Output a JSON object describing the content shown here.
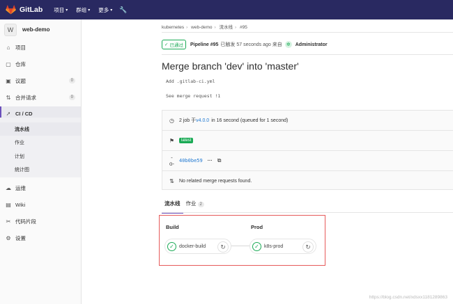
{
  "topnav": {
    "brand": "GitLab",
    "items": [
      {
        "label": "项目"
      },
      {
        "label": "群组"
      },
      {
        "label": "更多"
      }
    ]
  },
  "sidebar": {
    "project_initial": "W",
    "project_name": "web-demo",
    "items": [
      {
        "label": "项目",
        "icon": "home-icon"
      },
      {
        "label": "仓库",
        "icon": "repo-icon"
      },
      {
        "label": "议题",
        "icon": "issues-icon",
        "count": "0"
      },
      {
        "label": "合并请求",
        "icon": "merge-request-icon",
        "count": "0"
      },
      {
        "label": "CI / CD",
        "icon": "rocket-icon"
      },
      {
        "label": "运维",
        "icon": "cloud-icon"
      },
      {
        "label": "Wiki",
        "icon": "book-icon"
      },
      {
        "label": "代码片段",
        "icon": "snippet-icon"
      },
      {
        "label": "设置",
        "icon": "gear-icon"
      }
    ],
    "cicd_sub": [
      {
        "label": "流水线"
      },
      {
        "label": "作业"
      },
      {
        "label": "计划"
      },
      {
        "label": "统计图"
      }
    ]
  },
  "breadcrumb": [
    "kubernetes",
    "web-demo",
    "流水线",
    "#95"
  ],
  "pipeline": {
    "status": "已通过",
    "id_label": "Pipeline #95",
    "triggered_text": "已触发 57 seconds ago 来自",
    "user": "Administrator",
    "title": "Merge branch 'dev' into 'master'",
    "commit_lines": [
      "Add .gitlab-ci.yml",
      "See merge request !1"
    ],
    "jobs_text_1": "2 job 于",
    "tag": "v4.0.0",
    "jobs_text_2": "in 16 second (queued for 1 second)",
    "latest_badge": "latest",
    "sha": "40b0be59",
    "ellipsis": "···",
    "no_mr": "No related merge requests found."
  },
  "tabs": [
    {
      "label": "流水线"
    },
    {
      "label": "作业",
      "count": "2"
    }
  ],
  "graph": {
    "stages": [
      {
        "name": "Build",
        "job": "docker-build"
      },
      {
        "name": "Prod",
        "job": "k8s-prod"
      }
    ]
  },
  "watermark": "https://blog.csdn.net/xdsxx1181289863"
}
